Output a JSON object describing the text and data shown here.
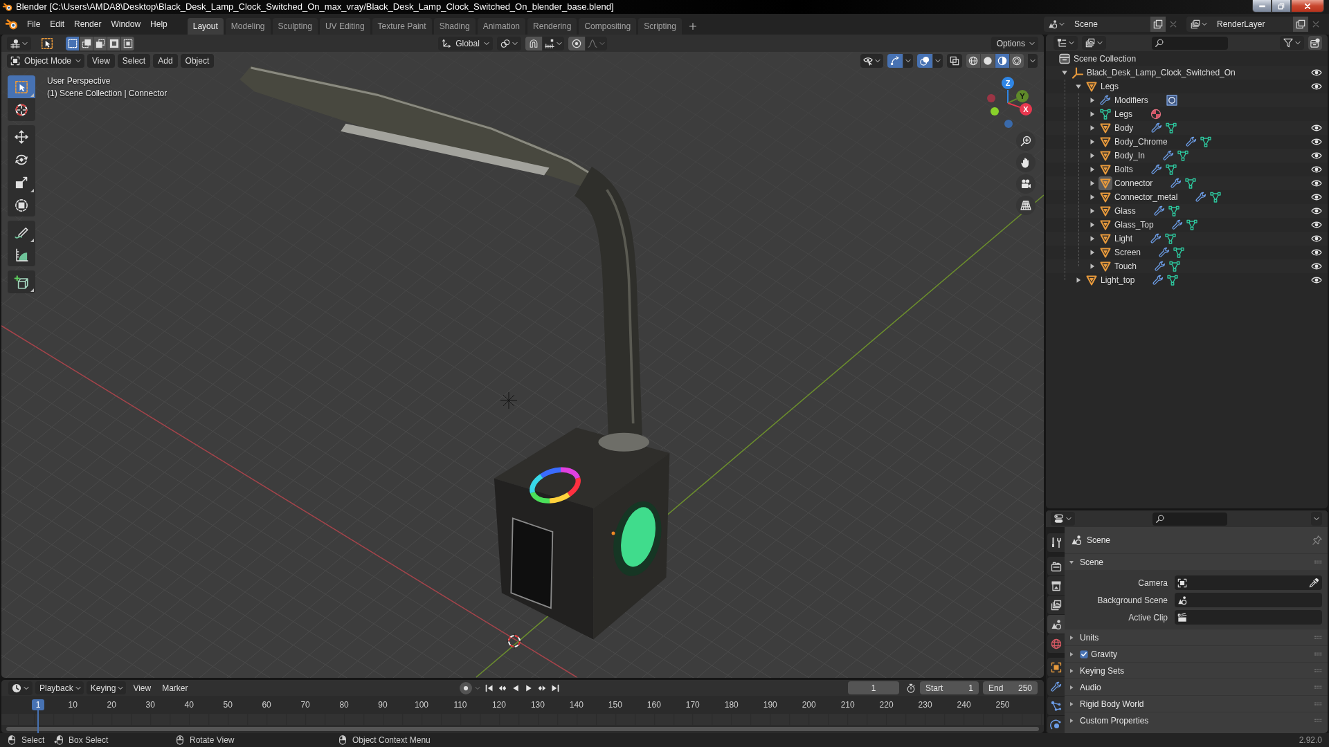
{
  "window": {
    "title": "Blender [C:\\Users\\AMDA8\\Desktop\\Black_Desk_Lamp_Clock_Switched_On_max_vray/Black_Desk_Lamp_Clock_Switched_On_blender_base.blend]"
  },
  "menu": [
    "File",
    "Edit",
    "Render",
    "Window",
    "Help"
  ],
  "workspaces": [
    {
      "label": "Layout",
      "selected": true
    },
    {
      "label": "Modeling",
      "selected": false
    },
    {
      "label": "Sculpting",
      "selected": false
    },
    {
      "label": "UV Editing",
      "selected": false
    },
    {
      "label": "Texture Paint",
      "selected": false
    },
    {
      "label": "Shading",
      "selected": false
    },
    {
      "label": "Animation",
      "selected": false
    },
    {
      "label": "Rendering",
      "selected": false
    },
    {
      "label": "Compositing",
      "selected": false
    },
    {
      "label": "Scripting",
      "selected": false
    }
  ],
  "scene_selector": {
    "scene": "Scene",
    "view_layer": "RenderLayer"
  },
  "viewport": {
    "select_modes": [
      {
        "kind": "set",
        "selected": true
      },
      {
        "kind": "extend",
        "selected": false
      },
      {
        "kind": "subtract",
        "selected": false
      },
      {
        "kind": "difference",
        "selected": false
      },
      {
        "kind": "intersect",
        "selected": false
      }
    ],
    "orientation": "Global",
    "options": "Options",
    "mode": "Object Mode",
    "menus": [
      "View",
      "Select",
      "Add",
      "Object"
    ],
    "display_toggles": [
      {
        "kind": "visibility",
        "selected": false
      },
      {
        "kind": "gizmos",
        "selected": true
      },
      {
        "kind": "overlays",
        "selected": true
      },
      {
        "kind": "xray",
        "selected": false
      }
    ],
    "shading": [
      {
        "kind": "wireframe",
        "selected": false
      },
      {
        "kind": "solid",
        "selected": false
      },
      {
        "kind": "material",
        "selected": true
      },
      {
        "kind": "rendered",
        "selected": false
      }
    ],
    "info": [
      "User Perspective",
      "(1) Scene Collection | Connector"
    ],
    "tool_groups": [
      [
        {
          "kind": "select_box",
          "selected": true
        },
        {
          "kind": "cursor",
          "selected": false
        }
      ],
      [
        {
          "kind": "move",
          "selected": false
        },
        {
          "kind": "rotate",
          "selected": false
        },
        {
          "kind": "scale",
          "selected": false
        },
        {
          "kind": "transform",
          "selected": false
        }
      ],
      [
        {
          "kind": "annotate",
          "selected": false
        },
        {
          "kind": "measure",
          "selected": false
        }
      ],
      [
        {
          "kind": "add_cube",
          "selected": false
        }
      ]
    ],
    "gizmo_axes": [
      "Z",
      "Y",
      "X"
    ]
  },
  "outliner": {
    "root": "Scene Collection",
    "tree": [
      {
        "name": "Black_Desk_Lamp_Clock_Switched_On",
        "kind": "empty",
        "expanded": true,
        "selected": false,
        "visible": true,
        "children": [
          {
            "name": "Legs",
            "kind": "object",
            "expanded": true,
            "selected": false,
            "visible": true,
            "children": [
              {
                "name": "Modifiers",
                "kind": "modifiers",
                "expanded": false,
                "selected": false
              },
              {
                "name": "Legs",
                "kind": "mesh",
                "expanded": false,
                "selected": false
              },
              {
                "name": "Body",
                "kind": "object",
                "expanded": false,
                "selected": false,
                "visible": true
              },
              {
                "name": "Body_Chrome",
                "kind": "object",
                "expanded": false,
                "selected": false,
                "visible": true
              },
              {
                "name": "Body_In",
                "kind": "object",
                "expanded": false,
                "selected": false,
                "visible": true
              },
              {
                "name": "Bolts",
                "kind": "object",
                "expanded": false,
                "selected": false,
                "visible": true
              },
              {
                "name": "Connector",
                "kind": "object",
                "expanded": false,
                "selected": true,
                "visible": true
              },
              {
                "name": "Connector_metal",
                "kind": "object",
                "expanded": false,
                "selected": false,
                "visible": true
              },
              {
                "name": "Glass",
                "kind": "object",
                "expanded": false,
                "selected": false,
                "visible": true
              },
              {
                "name": "Glass_Top",
                "kind": "object",
                "expanded": false,
                "selected": false,
                "visible": true
              },
              {
                "name": "Light",
                "kind": "object",
                "expanded": false,
                "selected": false,
                "visible": true
              },
              {
                "name": "Screen",
                "kind": "object",
                "expanded": false,
                "selected": false,
                "visible": true
              },
              {
                "name": "Touch",
                "kind": "object",
                "expanded": false,
                "selected": false,
                "visible": true
              }
            ]
          },
          {
            "name": "Light_top",
            "kind": "object",
            "expanded": false,
            "selected": false,
            "visible": true
          }
        ]
      }
    ]
  },
  "properties": {
    "tab_groups": [
      [
        {
          "kind": "tool",
          "selected": false
        }
      ],
      [
        {
          "kind": "render",
          "selected": false
        },
        {
          "kind": "output",
          "selected": false
        },
        {
          "kind": "view_layer",
          "selected": false
        },
        {
          "kind": "scene",
          "selected": true
        },
        {
          "kind": "world",
          "selected": false
        }
      ],
      [
        {
          "kind": "object",
          "selected": false
        },
        {
          "kind": "modifiers",
          "selected": false
        },
        {
          "kind": "particles",
          "selected": false
        },
        {
          "kind": "physics",
          "selected": false
        }
      ]
    ],
    "context": "Scene",
    "panels": [
      {
        "title": "Scene",
        "expanded": true,
        "fields": [
          {
            "label": "Camera",
            "kind": "camera"
          },
          {
            "label": "Background Scene",
            "kind": "scene"
          },
          {
            "label": "Active Clip",
            "kind": "clip"
          }
        ]
      },
      {
        "title": "Units",
        "expanded": false
      },
      {
        "title": "Gravity",
        "expanded": false,
        "checked": true
      },
      {
        "title": "Keying Sets",
        "expanded": false
      },
      {
        "title": "Audio",
        "expanded": false
      },
      {
        "title": "Rigid Body World",
        "expanded": false
      },
      {
        "title": "Custom Properties",
        "expanded": false
      }
    ]
  },
  "timeline": {
    "menus": [
      {
        "label": "Playback",
        "dropdown": true
      },
      {
        "label": "Keying",
        "dropdown": true
      },
      {
        "label": "View",
        "dropdown": false
      },
      {
        "label": "Marker",
        "dropdown": false
      }
    ],
    "current_frame": "1",
    "start": {
      "label": "Start",
      "value": "1"
    },
    "end": {
      "label": "End",
      "value": "250"
    },
    "playhead": "1",
    "ruler": [
      "10",
      "20",
      "30",
      "40",
      "50",
      "60",
      "70",
      "80",
      "90",
      "100",
      "110",
      "120",
      "130",
      "140",
      "150",
      "160",
      "170",
      "180",
      "190",
      "200",
      "210",
      "220",
      "230",
      "240",
      "250"
    ]
  },
  "status_bar": {
    "hints": [
      {
        "kind": "left_click",
        "text": "Select"
      },
      {
        "kind": "left_drag",
        "text": "Box Select"
      },
      {
        "kind": "middle_drag",
        "text": "Rotate View"
      },
      {
        "kind": "right_click",
        "text": "Object Context Menu"
      }
    ],
    "version": "2.92.0"
  }
}
